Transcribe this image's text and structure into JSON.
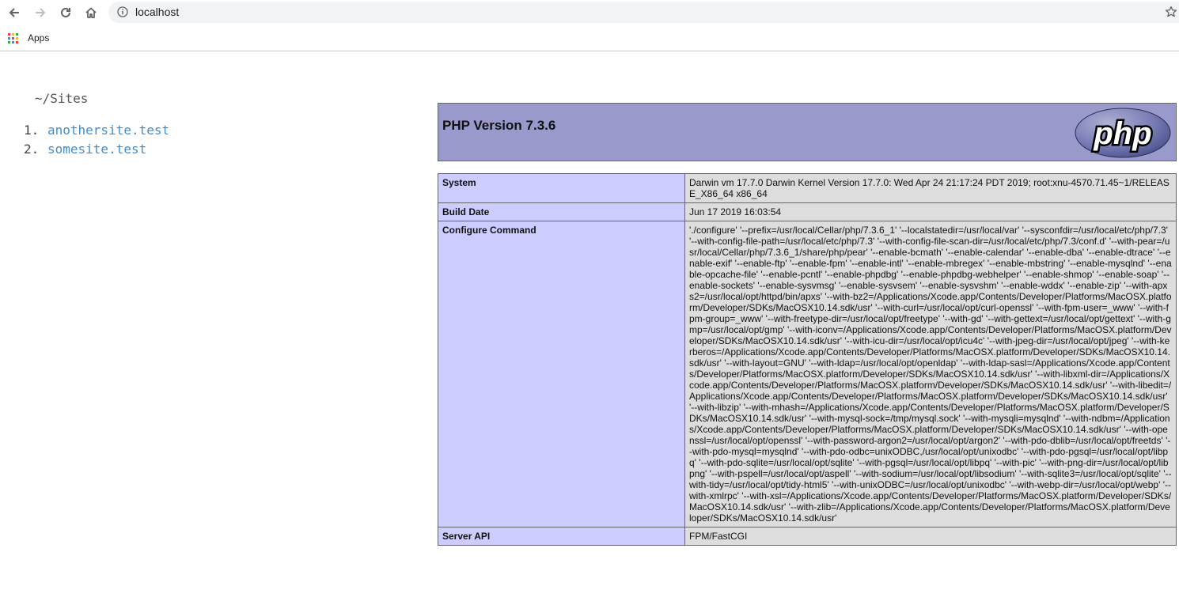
{
  "browser": {
    "url": "localhost",
    "bookmarks": {
      "apps_label": "Apps"
    },
    "icons": [
      "back-icon",
      "forward-icon",
      "reload-icon",
      "home-icon",
      "info-icon",
      "star-icon",
      "apps-grid-icon"
    ]
  },
  "sites": {
    "title": "~/Sites",
    "items": [
      {
        "num": "1.",
        "label": "anothersite.test"
      },
      {
        "num": "2.",
        "label": "somesite.test"
      }
    ]
  },
  "phpinfo": {
    "title": "PHP Version 7.3.6",
    "logo_text": "php",
    "rows": [
      {
        "key": "System",
        "value": "Darwin vm 17.7.0 Darwin Kernel Version 17.7.0: Wed Apr 24 21:17:24 PDT 2019; root:xnu-4570.71.45~1/RELEASE_X86_64 x86_64"
      },
      {
        "key": "Build Date",
        "value": "Jun 17 2019 16:03:54"
      },
      {
        "key": "Configure Command",
        "value": "'./configure' '--prefix=/usr/local/Cellar/php/7.3.6_1' '--localstatedir=/usr/local/var' '--sysconfdir=/usr/local/etc/php/7.3' '--with-config-file-path=/usr/local/etc/php/7.3' '--with-config-file-scan-dir=/usr/local/etc/php/7.3/conf.d' '--with-pear=/usr/local/Cellar/php/7.3.6_1/share/php/pear' '--enable-bcmath' '--enable-calendar' '--enable-dba' '--enable-dtrace' '--enable-exif' '--enable-ftp' '--enable-fpm' '--enable-intl' '--enable-mbregex' '--enable-mbstring' '--enable-mysqlnd' '--enable-opcache-file' '--enable-pcntl' '--enable-phpdbg' '--enable-phpdbg-webhelper' '--enable-shmop' '--enable-soap' '--enable-sockets' '--enable-sysvmsg' '--enable-sysvsem' '--enable-sysvshm' '--enable-wddx' '--enable-zip' '--with-apxs2=/usr/local/opt/httpd/bin/apxs' '--with-bz2=/Applications/Xcode.app/Contents/Developer/Platforms/MacOSX.platform/Developer/SDKs/MacOSX10.14.sdk/usr' '--with-curl=/usr/local/opt/curl-openssl' '--with-fpm-user=_www' '--with-fpm-group=_www' '--with-freetype-dir=/usr/local/opt/freetype' '--with-gd' '--with-gettext=/usr/local/opt/gettext' '--with-gmp=/usr/local/opt/gmp' '--with-iconv=/Applications/Xcode.app/Contents/Developer/Platforms/MacOSX.platform/Developer/SDKs/MacOSX10.14.sdk/usr' '--with-icu-dir=/usr/local/opt/icu4c' '--with-jpeg-dir=/usr/local/opt/jpeg' '--with-kerberos=/Applications/Xcode.app/Contents/Developer/Platforms/MacOSX.platform/Developer/SDKs/MacOSX10.14.sdk/usr' '--with-layout=GNU' '--with-ldap=/usr/local/opt/openldap' '--with-ldap-sasl=/Applications/Xcode.app/Contents/Developer/Platforms/MacOSX.platform/Developer/SDKs/MacOSX10.14.sdk/usr' '--with-libxml-dir=/Applications/Xcode.app/Contents/Developer/Platforms/MacOSX.platform/Developer/SDKs/MacOSX10.14.sdk/usr' '--with-libedit=/Applications/Xcode.app/Contents/Developer/Platforms/MacOSX.platform/Developer/SDKs/MacOSX10.14.sdk/usr' '--with-libzip' '--with-mhash=/Applications/Xcode.app/Contents/Developer/Platforms/MacOSX.platform/Developer/SDKs/MacOSX10.14.sdk/usr' '--with-mysql-sock=/tmp/mysql.sock' '--with-mysqli=mysqlnd' '--with-ndbm=/Applications/Xcode.app/Contents/Developer/Platforms/MacOSX.platform/Developer/SDKs/MacOSX10.14.sdk/usr' '--with-openssl=/usr/local/opt/openssl' '--with-password-argon2=/usr/local/opt/argon2' '--with-pdo-dblib=/usr/local/opt/freetds' '--with-pdo-mysql=mysqlnd' '--with-pdo-odbc=unixODBC,/usr/local/opt/unixodbc' '--with-pdo-pgsql=/usr/local/opt/libpq' '--with-pdo-sqlite=/usr/local/opt/sqlite' '--with-pgsql=/usr/local/opt/libpq' '--with-pic' '--with-png-dir=/usr/local/opt/libpng' '--with-pspell=/usr/local/opt/aspell' '--with-sodium=/usr/local/opt/libsodium' '--with-sqlite3=/usr/local/opt/sqlite' '--with-tidy=/usr/local/opt/tidy-html5' '--with-unixODBC=/usr/local/opt/unixodbc' '--with-webp-dir=/usr/local/opt/webp' '--with-xmlrpc' '--with-xsl=/Applications/Xcode.app/Contents/Developer/Platforms/MacOSX.platform/Developer/SDKs/MacOSX10.14.sdk/usr' '--with-zlib=/Applications/Xcode.app/Contents/Developer/Platforms/MacOSX.platform/Developer/SDKs/MacOSX10.14.sdk/usr'"
      },
      {
        "key": "Server API",
        "value": "FPM/FastCGI"
      }
    ]
  },
  "colors": {
    "php_header": "#9999cc",
    "row_key": "#ccccff",
    "row_value": "#dddddd",
    "link": "#3d8fd1"
  }
}
